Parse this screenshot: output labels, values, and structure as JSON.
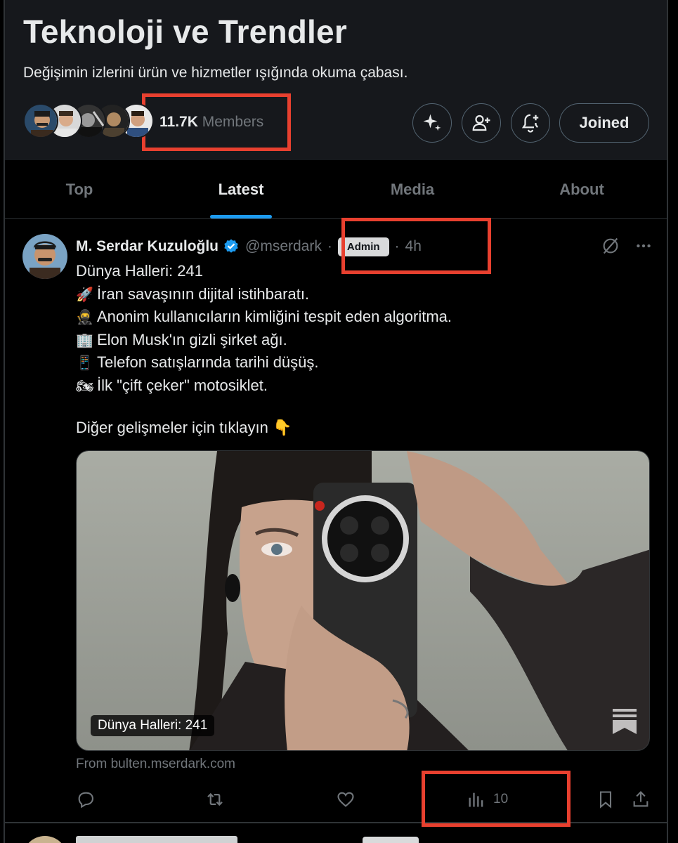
{
  "community": {
    "title": "Teknoloji ve Trendler",
    "description": "Değişimin izlerini ürün ve hizmetler ışığında okuma çabası.",
    "members_count": "11.7K",
    "members_label": "Members",
    "joined_label": "Joined",
    "member_avatar_icons": [
      "avatar",
      "avatar",
      "avatar",
      "avatar",
      "avatar"
    ]
  },
  "tabs": [
    {
      "label": "Top",
      "active": false
    },
    {
      "label": "Latest",
      "active": true
    },
    {
      "label": "Media",
      "active": false
    },
    {
      "label": "About",
      "active": false
    }
  ],
  "post": {
    "author": "M. Serdar Kuzuloğlu",
    "handle": "@mserdark",
    "badge": "Admin",
    "separator": "·",
    "time": "4h",
    "lines": [
      {
        "emoji": "",
        "text": "Dünya Halleri: 241"
      },
      {
        "emoji": "🚀",
        "text": "İran savaşının dijital istihbaratı."
      },
      {
        "emoji": "🥷",
        "text": "Anonim kullanıcıların kimliğini tespit eden algoritma."
      },
      {
        "emoji": "🏢",
        "text": "Elon Musk'ın gizli şirket ağı."
      },
      {
        "emoji": "📱",
        "text": "Telefon satışlarında tarihi düşüş."
      },
      {
        "emoji": "🏍",
        "text": "İlk \"çift çeker\" motosiklet."
      }
    ],
    "cta": "Diğer gelişmeler için tıklayın 👇",
    "media_caption": "Dünya Halleri: 241",
    "from_link": "From bulten.mserdark.com",
    "views": "10"
  },
  "colors": {
    "accent": "#1d9bf0",
    "highlight": "#e8402f",
    "verified": "#1d9bf0"
  }
}
